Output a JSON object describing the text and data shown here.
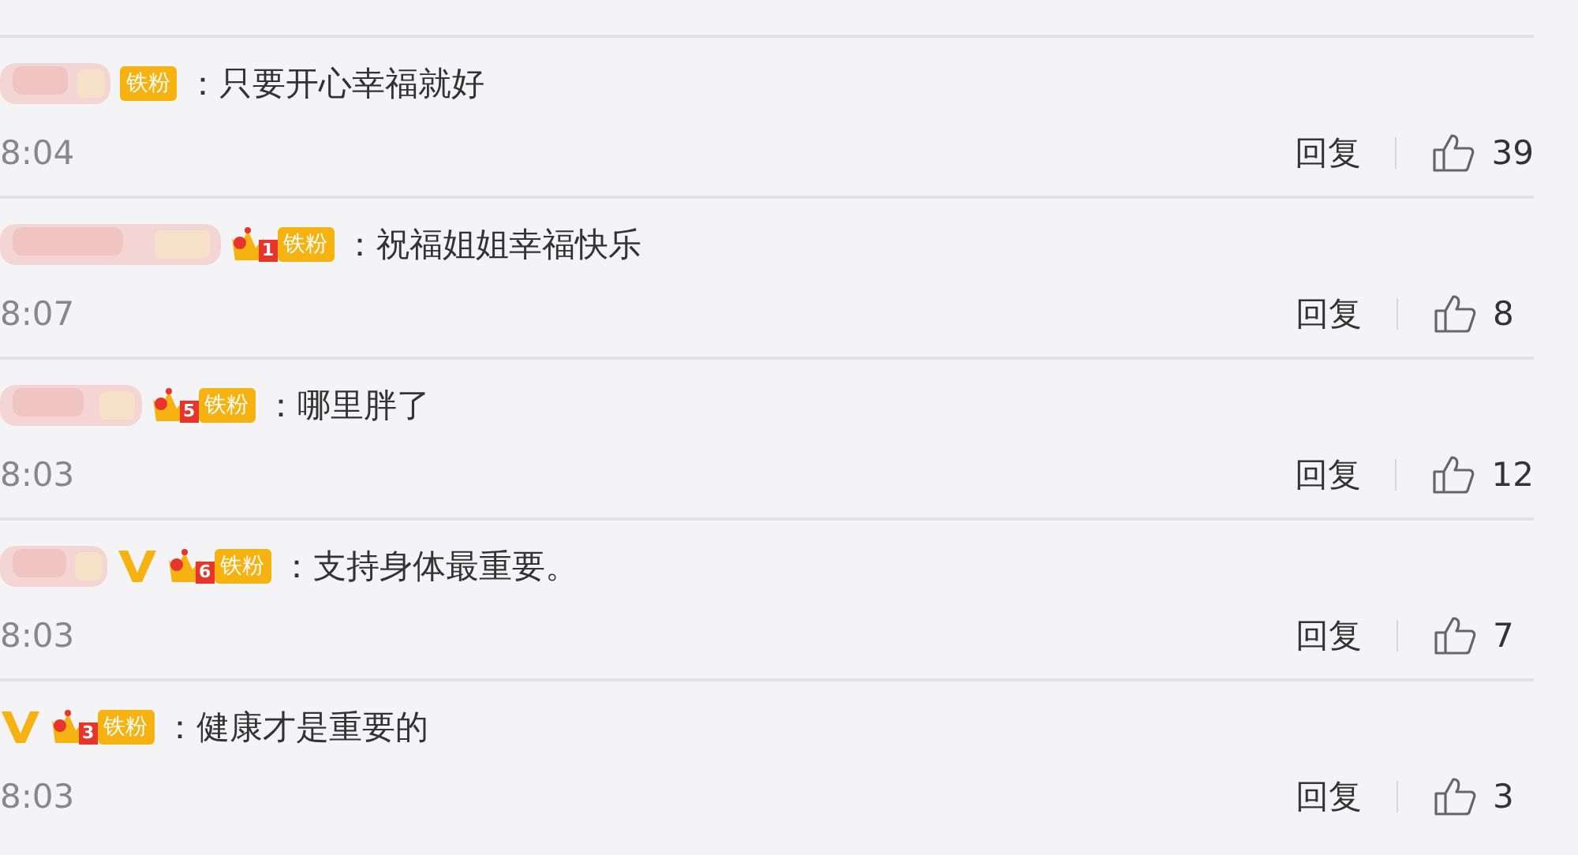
{
  "comments": [
    {
      "vip": false,
      "badge": {
        "crown": false,
        "label": "铁粉"
      },
      "text": "：只要开心幸福就好",
      "time": "8:04",
      "reply": "回复",
      "likes": "39"
    },
    {
      "vip": false,
      "badge": {
        "crown": true,
        "rank": "1",
        "label": "铁粉"
      },
      "text": "：祝福姐姐幸福快乐",
      "time": "8:07",
      "reply": "回复",
      "likes": "8"
    },
    {
      "vip": false,
      "badge": {
        "crown": true,
        "rank": "5",
        "label": "铁粉"
      },
      "text": "：哪里胖了",
      "time": "8:03",
      "reply": "回复",
      "likes": "12"
    },
    {
      "vip": true,
      "badge": {
        "crown": true,
        "rank": "6",
        "label": "铁粉"
      },
      "text": "：支持身体最重要。",
      "time": "8:03",
      "reply": "回复",
      "likes": "7"
    },
    {
      "vip": true,
      "badge": {
        "crown": true,
        "rank": "3",
        "label": "铁粉"
      },
      "text": "：健康才是重要的",
      "time": "8:03",
      "reply": "回复",
      "likes": "3"
    }
  ]
}
